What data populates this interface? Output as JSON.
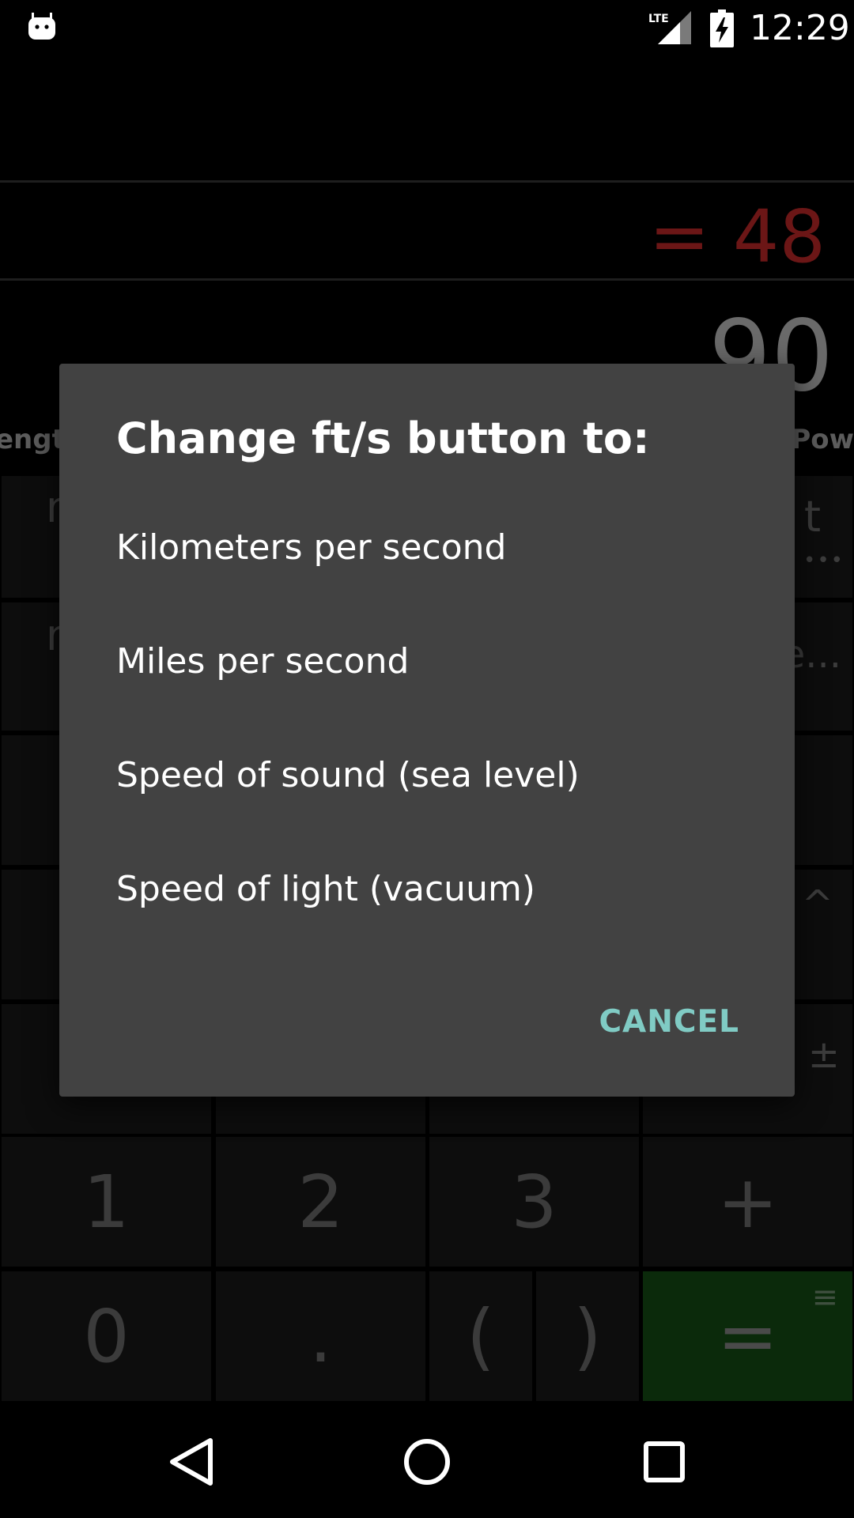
{
  "status_bar": {
    "time": "12:29",
    "network": "LTE",
    "icons": [
      "android-icon",
      "lte-signal-icon",
      "battery-charging-icon"
    ]
  },
  "calculator": {
    "result": "= 48",
    "display": "90",
    "tab_left": "ength",
    "tab_right": "Pow",
    "keys": {
      "one": "1",
      "two": "2",
      "three": "3",
      "plus": "+",
      "zero": "0",
      "dot": ".",
      "paren_open": "(",
      "paren_close": ")",
      "equals": "="
    },
    "side_glyphs": {
      "caret": "^",
      "plus_minus": "±",
      "menu": "≡"
    },
    "partial_keys": {
      "left_row1": "n",
      "left_row2": "n",
      "right_row1": "t",
      "right_row1_dots": "•••",
      "right_row2": "e..."
    }
  },
  "dialog": {
    "title": "Change ft/s button to:",
    "options": [
      "Kilometers per second",
      "Miles per second",
      "Speed of sound (sea level)",
      "Speed of light (vacuum)"
    ],
    "cancel": "CANCEL",
    "colors": {
      "background": "#424242",
      "accent": "#80cbc4"
    }
  },
  "nav": {
    "back": "back-icon",
    "home": "home-icon",
    "recents": "recents-icon"
  }
}
